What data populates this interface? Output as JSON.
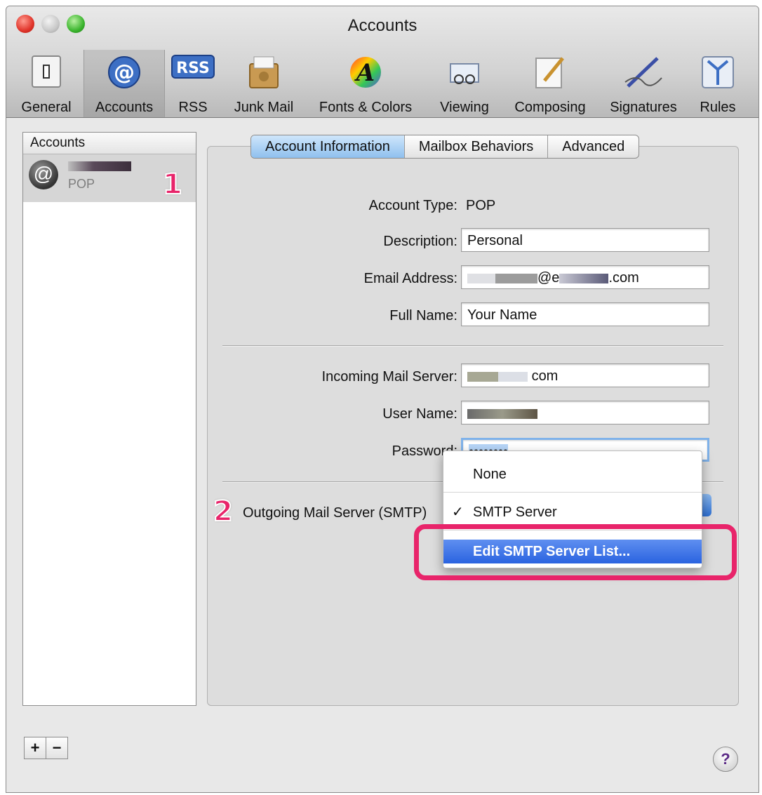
{
  "window": {
    "title": "Accounts"
  },
  "toolbar": [
    {
      "label": "General",
      "icon": "switch-icon"
    },
    {
      "label": "Accounts",
      "icon": "at-icon"
    },
    {
      "label": "RSS",
      "icon": "rss-icon"
    },
    {
      "label": "Junk Mail",
      "icon": "junk-mail-icon"
    },
    {
      "label": "Fonts & Colors",
      "icon": "fonts-colors-icon"
    },
    {
      "label": "Viewing",
      "icon": "viewing-icon"
    },
    {
      "label": "Composing",
      "icon": "composing-icon"
    },
    {
      "label": "Signatures",
      "icon": "signatures-icon"
    },
    {
      "label": "Rules",
      "icon": "rules-icon"
    }
  ],
  "sidebar": {
    "header": "Accounts",
    "accounts": [
      {
        "type": "POP"
      }
    ]
  },
  "annotations": {
    "step1": "1",
    "step2": "2"
  },
  "tabs": [
    "Account Information",
    "Mailbox Behaviors",
    "Advanced"
  ],
  "form": {
    "account_type_label": "Account Type:",
    "account_type_value": "POP",
    "description_label": "Description:",
    "description_value": "Personal",
    "email_label": "Email Address:",
    "email_suffix": "@e",
    "email_domain_end": ".com",
    "full_name_label": "Full Name:",
    "full_name_value": "Your Name",
    "incoming_label": "Incoming Mail Server:",
    "incoming_suffix": "com",
    "username_label": "User Name:",
    "password_label": "Password:",
    "password_value": "••••••••",
    "outgoing_label": "Outgoing Mail Server (SMTP)"
  },
  "smtp_menu": {
    "items": [
      "None",
      "SMTP Server",
      "Edit SMTP Server List..."
    ],
    "selected": "SMTP Server",
    "check": "✓"
  },
  "buttons": {
    "add": "+",
    "remove": "−",
    "help": "?"
  },
  "colors": {
    "highlight": "#e8246a",
    "selection": "#2a63e0"
  }
}
